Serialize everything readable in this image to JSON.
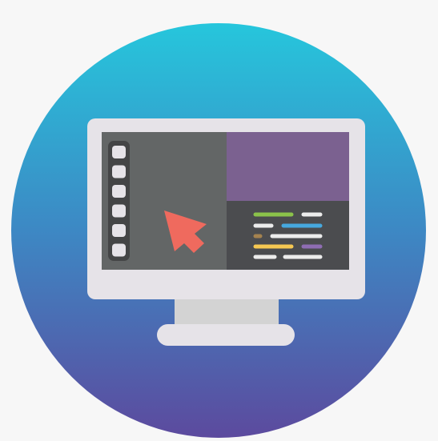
{
  "illustration": {
    "subject": "desktop-monitor-with-cursor-icon",
    "colors": {
      "page_background": "#f7f7f7",
      "circle_gradient_top": "#26c6dc",
      "circle_gradient_mid": "#3d88c4",
      "circle_gradient_bottom": "#5c4a9e",
      "monitor_frame": "#e6e3e8",
      "monitor_neck": "#d3d3d3",
      "monitor_base": "#e6e3e8",
      "screen_left_panel": "#636666",
      "screen_top_right_panel": "#7b6190",
      "screen_bottom_right_panel": "#4b4c4f",
      "toolbar_bg": "#444546",
      "toolbar_button": "#e6e3e8",
      "cursor": "#ef6a5e",
      "code_green": "#8bc24a",
      "code_white": "#ececec",
      "code_blue": "#46a8de",
      "code_brown": "#a4824f",
      "code_yellow": "#f6c852",
      "code_purple": "#8e6db3"
    },
    "toolbar_button_count": 6
  }
}
